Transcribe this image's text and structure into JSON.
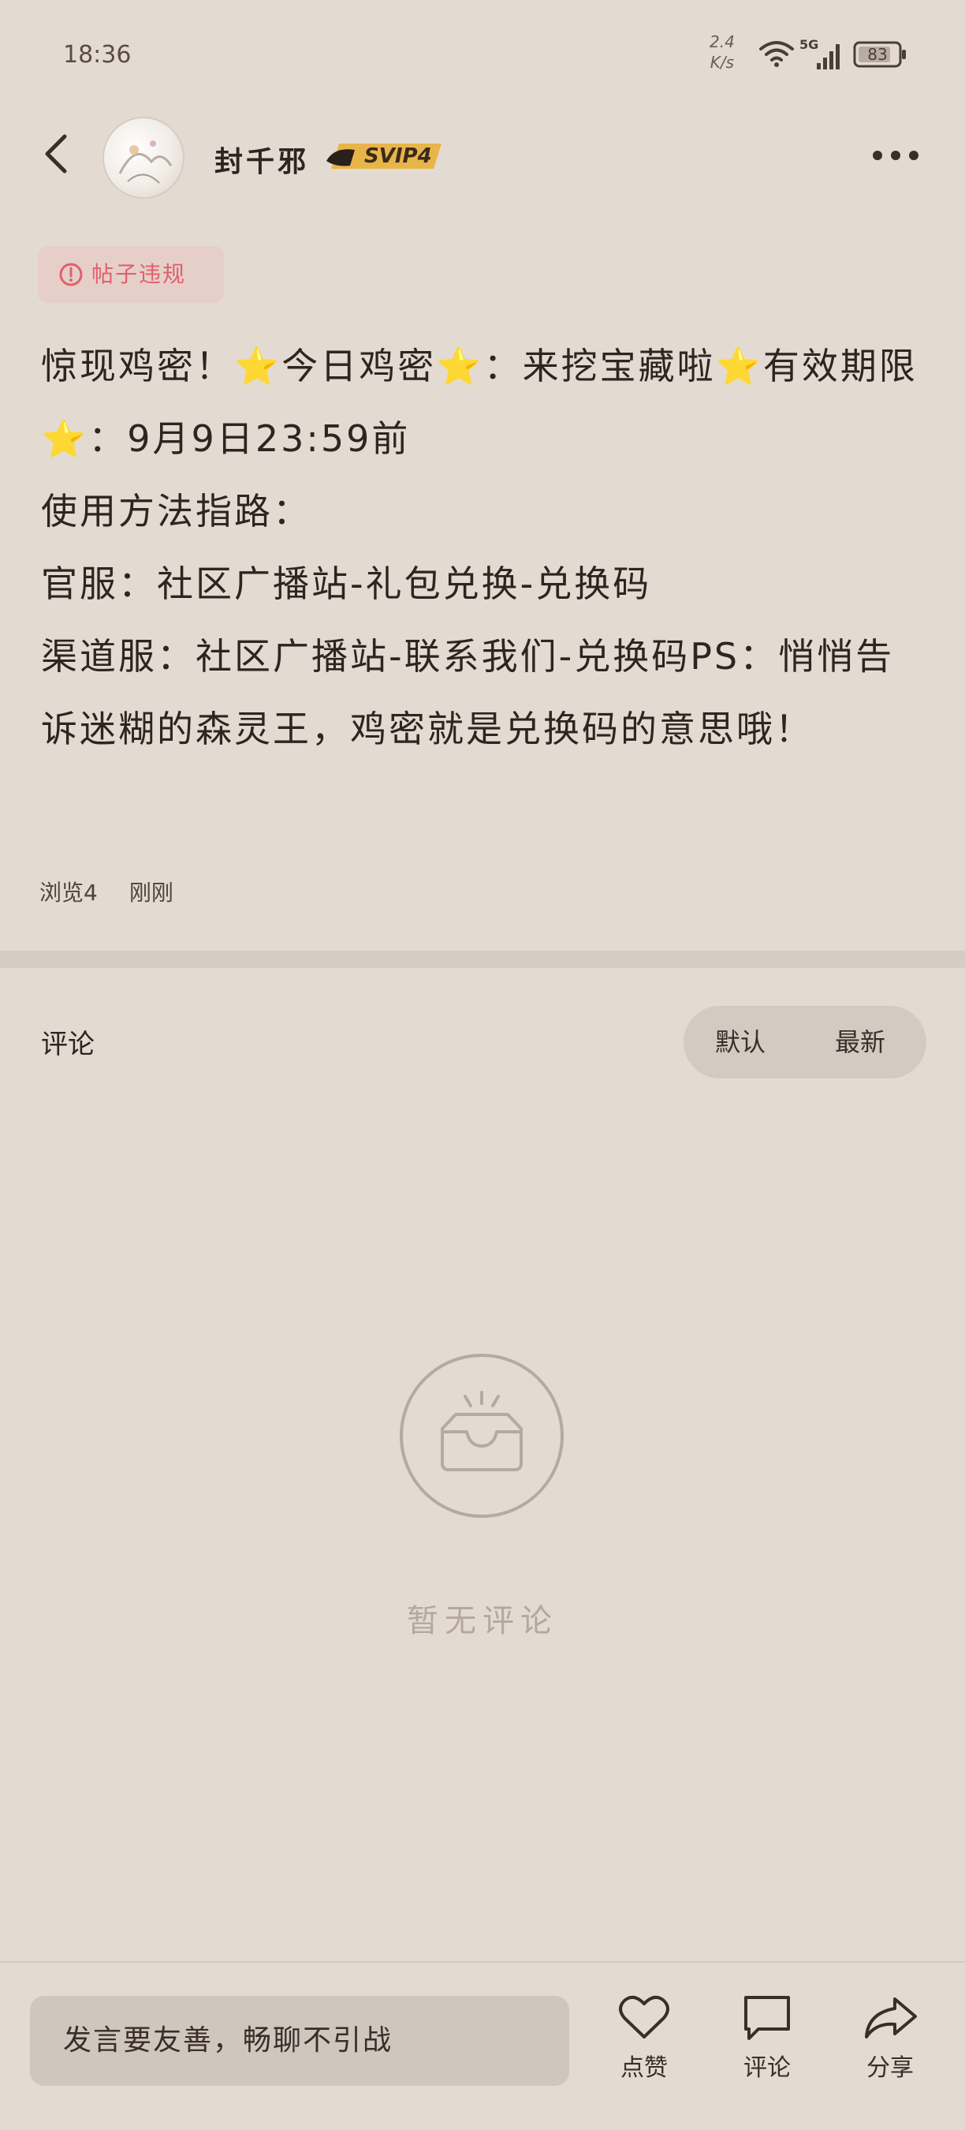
{
  "status_bar": {
    "time": "18:36",
    "net_speed_value": "2.4",
    "net_speed_unit": "K/s",
    "network": "5G",
    "battery": "83",
    "icons": [
      "wifi-icon",
      "signal-icon",
      "battery-icon"
    ]
  },
  "header": {
    "username": "封千邪",
    "vip_badge": "SVIP4",
    "icons": [
      "back-arrow-icon",
      "more-icon"
    ]
  },
  "violation_tag": {
    "label": "帖子违规",
    "icon": "alert-circle-icon",
    "color": "#e0606c"
  },
  "post": {
    "line1_a": "惊现鸡密！",
    "line1_b": "今日鸡密",
    "line1_c": "：来挖宝藏啦",
    "line1_d": "有效期限",
    "line1_e": "：9月9日23:59前",
    "line2": "使用方法指路：",
    "line3": "官服：社区广播站-礼包兑换-兑换码",
    "line4": "渠道服：社区广播站-联系我们-兑换码PS：悄悄告诉迷糊的森灵王，鸡密就是兑换码的意思哦！",
    "star": "⭐",
    "views": "浏览4",
    "time": "刚刚"
  },
  "comments": {
    "title": "评论",
    "sort_default": "默认",
    "sort_newest": "最新",
    "empty_text": "暂无评论"
  },
  "bottom_bar": {
    "input_placeholder": "发言要友善，畅聊不引战",
    "like": "点赞",
    "comment": "评论",
    "share": "分享"
  },
  "colors": {
    "background": "#e3dbd1",
    "text": "#2e2420",
    "star": "#f2c14b",
    "vip_gold": "#e8b54a"
  }
}
